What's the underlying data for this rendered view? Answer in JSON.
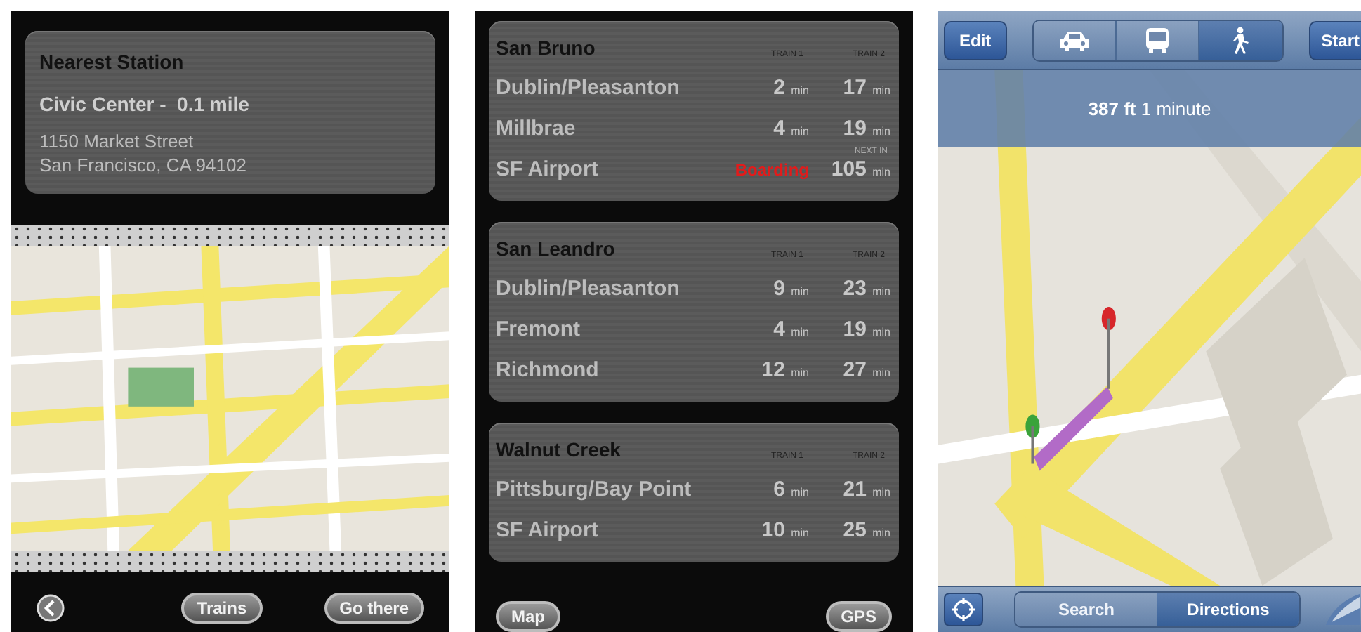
{
  "nearest_station": {
    "title": "Nearest Station",
    "station": "Civic Center -  0.1 mile",
    "address_lines": [
      "1150 Market Street",
      "San Francisco, CA 94102"
    ]
  },
  "station_bar": {
    "buttons": [
      "Trains",
      "Go there"
    ]
  },
  "departures": [
    {
      "station": "San Bruno",
      "columns": [
        "TRAIN 1",
        "TRAIN 2"
      ],
      "rows": [
        {
          "destination": "Dublin/Pleasanton",
          "times": [
            {
              "kind": "time",
              "value": "2",
              "unit": "min"
            },
            {
              "kind": "time",
              "value": "17",
              "unit": "min"
            }
          ]
        },
        {
          "destination": "Millbrae",
          "times": [
            {
              "kind": "time",
              "value": "4",
              "unit": "min"
            },
            {
              "kind": "time",
              "value": "19",
              "unit": "min"
            }
          ]
        },
        {
          "destination": "SF Airport",
          "times": [
            {
              "kind": "status",
              "value": "Boarding"
            },
            {
              "kind": "time",
              "note": "NEXT IN",
              "value": "105",
              "unit": "min"
            }
          ]
        }
      ]
    },
    {
      "station": "San Leandro",
      "columns": [
        "TRAIN 1",
        "TRAIN 2"
      ],
      "rows": [
        {
          "destination": "Dublin/Pleasanton",
          "times": [
            {
              "kind": "time",
              "value": "9",
              "unit": "min"
            },
            {
              "kind": "time",
              "value": "23",
              "unit": "min"
            }
          ]
        },
        {
          "destination": "Fremont",
          "times": [
            {
              "kind": "time",
              "value": "4",
              "unit": "min"
            },
            {
              "kind": "time",
              "value": "19",
              "unit": "min"
            }
          ]
        },
        {
          "destination": "Richmond",
          "times": [
            {
              "kind": "time",
              "value": "12",
              "unit": "min"
            },
            {
              "kind": "time",
              "value": "27",
              "unit": "min"
            }
          ]
        }
      ]
    },
    {
      "station": "Walnut Creek",
      "columns": [
        "TRAIN 1",
        "TRAIN 2"
      ],
      "rows": [
        {
          "destination": "Pittsburg/Bay Point",
          "times": [
            {
              "kind": "time",
              "value": "6",
              "unit": "min"
            },
            {
              "kind": "time",
              "value": "21",
              "unit": "min"
            }
          ]
        },
        {
          "destination": "SF Airport",
          "times": [
            {
              "kind": "time",
              "value": "10",
              "unit": "min"
            },
            {
              "kind": "time",
              "value": "25",
              "unit": "min"
            }
          ]
        }
      ]
    }
  ],
  "departures_bar": {
    "buttons": [
      "Map",
      "GPS"
    ]
  },
  "directions": {
    "edit": "Edit",
    "start": "Start",
    "modes": [
      {
        "kind": "car",
        "selected": false
      },
      {
        "kind": "bus",
        "selected": false
      },
      {
        "kind": "walk",
        "selected": true
      }
    ],
    "summary": {
      "distance": "387 ft",
      "duration": "1 minute"
    },
    "tabs": [
      {
        "label": "Search",
        "selected": false
      },
      {
        "label": "Directions",
        "selected": true
      }
    ]
  }
}
